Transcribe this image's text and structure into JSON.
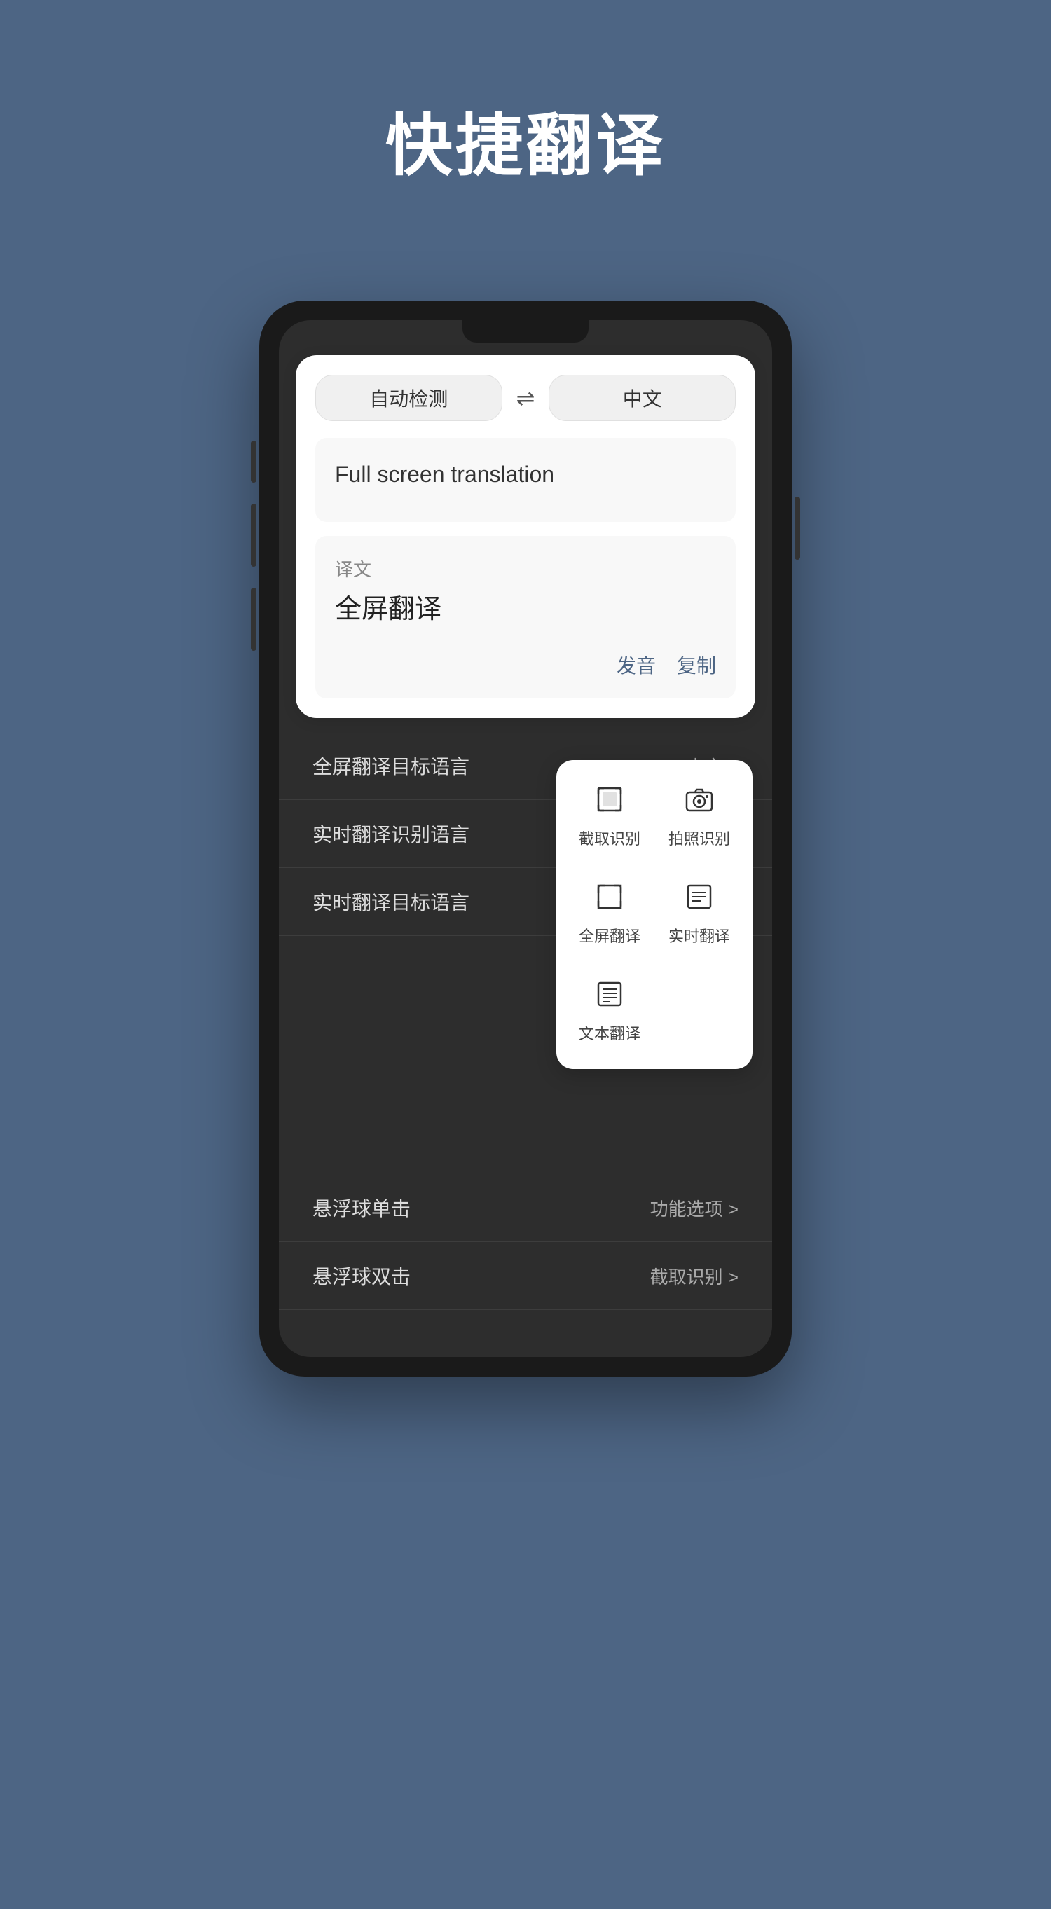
{
  "page": {
    "title": "快捷翻译",
    "background_color": "#4d6584"
  },
  "phone": {
    "screen": {
      "lang_selector": {
        "source_lang": "自动检测",
        "swap_icon": "⇌",
        "target_lang": "中文"
      },
      "input_area": {
        "text": "Full screen translation"
      },
      "result_area": {
        "label": "译文",
        "translated_text": "全屏翻译",
        "action_pronounce": "发音",
        "action_copy": "复制"
      },
      "settings": [
        {
          "label": "全屏翻译目标语言",
          "value": "中文 >"
        },
        {
          "label": "实时翻译识别语言",
          "value": ""
        },
        {
          "label": "实时翻译目标语言",
          "value": ""
        },
        {
          "label": "悬浮球单击",
          "value": ""
        },
        {
          "label": "悬浮球双击",
          "value": "截取识别 >"
        }
      ],
      "quick_panel": {
        "items": [
          {
            "icon": "crop",
            "label": "截取识别",
            "unicode": "✂"
          },
          {
            "icon": "camera",
            "label": "拍照识别",
            "unicode": "📷"
          },
          {
            "icon": "fullscreen",
            "label": "全屏翻译",
            "unicode": "⛶"
          },
          {
            "icon": "realtime",
            "label": "实时翻译",
            "unicode": "⊟"
          },
          {
            "icon": "text",
            "label": "文本翻译",
            "unicode": "≡"
          }
        ]
      }
    }
  }
}
